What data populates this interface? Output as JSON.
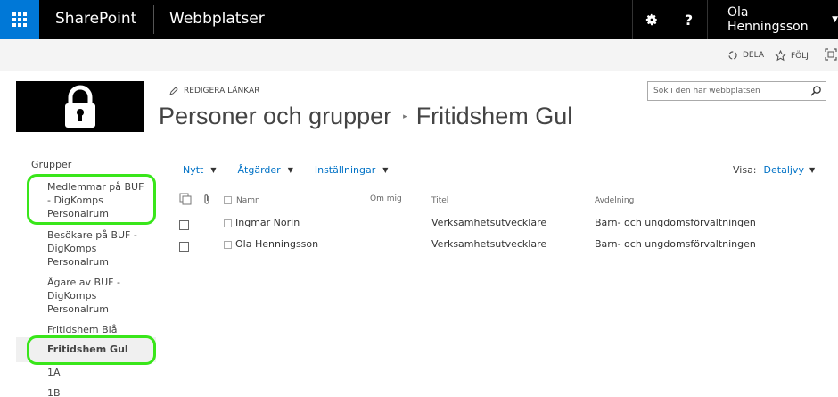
{
  "suitebar": {
    "brand": "SharePoint",
    "site": "Webbplatser",
    "user": "Ola Henningsson",
    "help": "?"
  },
  "ribbon": {
    "share": "DELA",
    "follow": "FÖLJ"
  },
  "header": {
    "edit_links": "REDIGERA LÄNKAR",
    "breadcrumb_parent": "Personer och grupper",
    "breadcrumb_current": "Fritidshem Gul",
    "search_placeholder": "Sök i den här webbplatsen"
  },
  "leftnav": {
    "header": "Grupper",
    "items": [
      {
        "label": "Medlemmar på BUF - DigKomps Personalrum",
        "selected": false
      },
      {
        "label": "Besökare på BUF - DigKomps Personalrum",
        "selected": false
      },
      {
        "label": "Ägare av BUF - DigKomps Personalrum",
        "selected": false
      },
      {
        "label": "Fritidshem Blå",
        "selected": false
      },
      {
        "label": "Fritidshem Gul",
        "selected": true
      },
      {
        "label": "1A",
        "selected": false
      },
      {
        "label": "1B",
        "selected": false
      }
    ]
  },
  "toolbar": {
    "new": "Nytt",
    "actions": "Åtgärder",
    "settings": "Inställningar",
    "view_label": "Visa:",
    "view_value": "Detaljvy"
  },
  "table": {
    "columns": {
      "name": "Namn",
      "about": "Om mig",
      "title": "Titel",
      "department": "Avdelning"
    },
    "rows": [
      {
        "name": "Ingmar Norin",
        "about": "",
        "title": "Verksamhetsutvecklare",
        "department": "Barn- och ungdomsförvaltningen"
      },
      {
        "name": "Ola Henningsson",
        "about": "",
        "title": "Verksamhetsutvecklare",
        "department": "Barn- och ungdomsförvaltningen"
      }
    ]
  },
  "colors": {
    "suitebar_bg": "#000000",
    "waffle_bg": "#0078d7",
    "link_blue": "#0072c6",
    "highlight_green": "#39e61a"
  }
}
